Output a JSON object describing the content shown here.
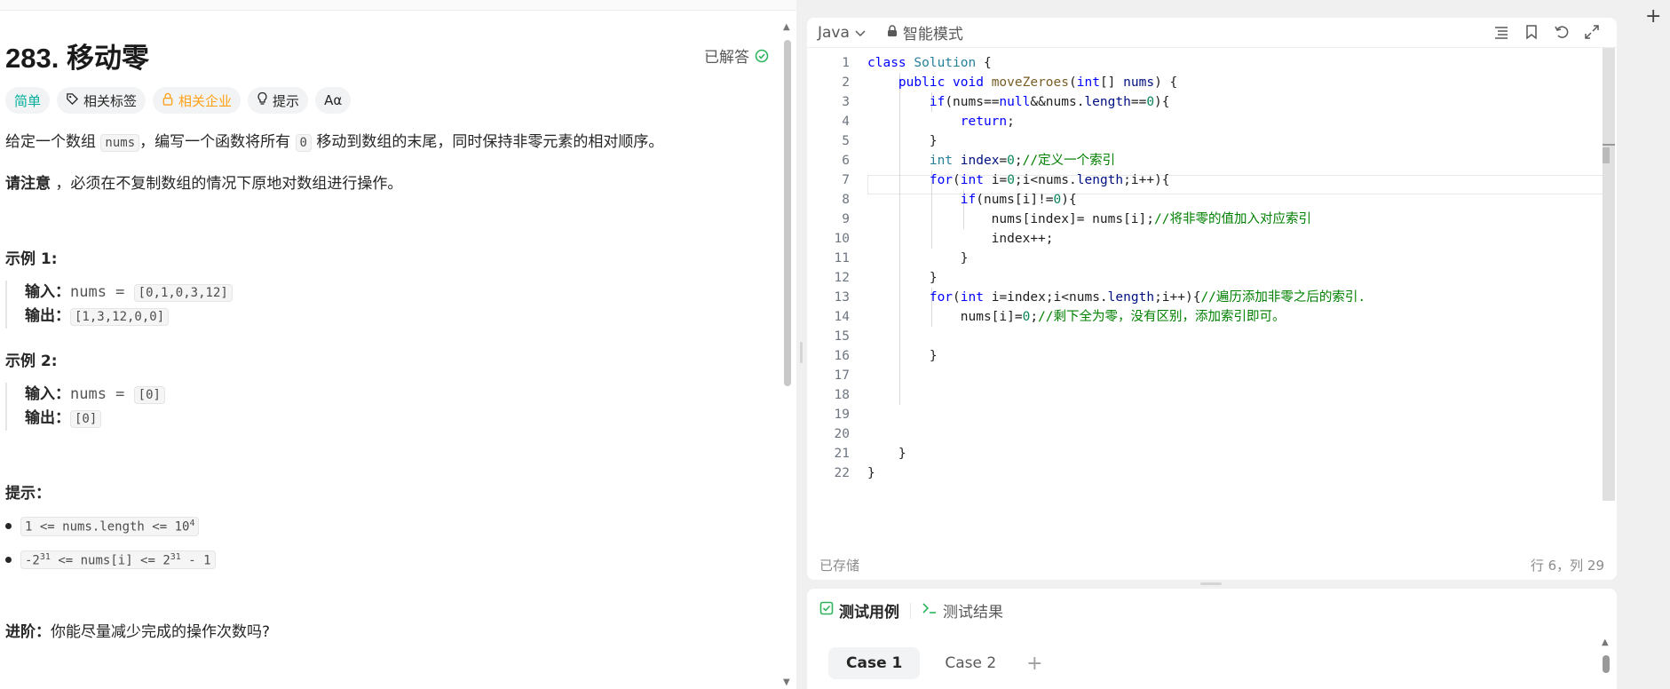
{
  "problem": {
    "title": "283. 移动零",
    "status": "已解答",
    "tags": {
      "difficulty": "简单",
      "related_tags": "相关标签",
      "related_companies": "相关企业",
      "hint": "提示",
      "font_toggle": "Aα"
    },
    "desc_before": "给定一个数组 ",
    "desc_code1": "nums",
    "desc_mid": "，编写一个函数将所有 ",
    "desc_code2": "0",
    "desc_after": " 移动到数组的末尾，同时保持非零元素的相对顺序。",
    "note_bold": "请注意",
    "note_rest": " ，必须在不复制数组的情况下原地对数组进行操作。",
    "examples": [
      {
        "title": "示例 1:",
        "input_label": "输入：",
        "input_name": "nums = ",
        "input_val": "[0,1,0,3,12]",
        "output_label": "输出：",
        "output_val": "[1,3,12,0,0]"
      },
      {
        "title": "示例 2:",
        "input_label": "输入：",
        "input_name": "nums = ",
        "input_val": "[0]",
        "output_label": "输出：",
        "output_val": "[0]"
      }
    ],
    "hints_title": "提示：",
    "constraint1_pre": "1 <= nums.length <= 10",
    "constraint1_exp": "4",
    "constraint2_a": "-2",
    "constraint2_exp1": "31",
    "constraint2_b": " <= nums[i] <= 2",
    "constraint2_exp2": "31",
    "constraint2_c": " - 1",
    "advance_bold": "进阶：",
    "advance_rest": "你能尽量减少完成的操作次数吗?"
  },
  "editor": {
    "language": "Java",
    "mode": "智能模式",
    "saved": "已存储",
    "cursor_pos": "行 6，列 29",
    "line_numbers": [
      "1",
      "2",
      "3",
      "4",
      "5",
      "6",
      "7",
      "8",
      "9",
      "10",
      "11",
      "12",
      "13",
      "14",
      "15",
      "16",
      "17",
      "18",
      "19",
      "20",
      "21",
      "22"
    ]
  },
  "tests": {
    "tab_cases": "测试用例",
    "tab_results": "测试结果",
    "case1": "Case 1",
    "case2": "Case 2",
    "add": "+"
  },
  "colors": {
    "easy": "#00af9b",
    "company": "#ffa116",
    "solved": "#2db55d"
  }
}
